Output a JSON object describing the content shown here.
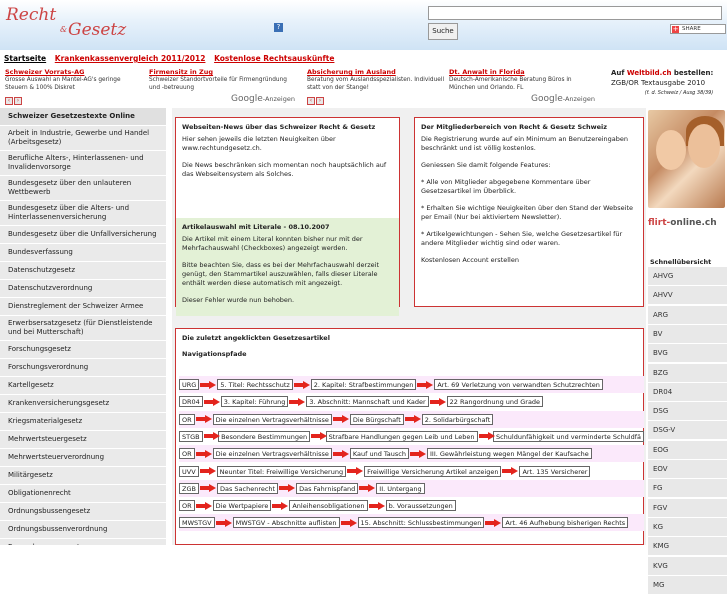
{
  "header": {
    "logo_line1": "Recht",
    "logo_amp": "&",
    "logo_line2": "Gesetz",
    "search_placeholder": "",
    "search_button": "Suche",
    "share_label": "SHARE",
    "help_icon_label": "?"
  },
  "topnav": [
    "Startseite",
    "Krankenkassenvergleich 2011/2012",
    "Kostenlose Rechtsauskünfte"
  ],
  "ads": [
    {
      "title": "Schweizer Vorrats-AG",
      "text": "Grosse Auswahl an Mantel-AG's geringe Steuern & 100% Diskret"
    },
    {
      "title": "Firmensitz in Zug",
      "text": "Schweizer Standortvorteile für Firmengründung und -betreuung"
    },
    {
      "title": "Absicherung im Ausland",
      "text": "Beratung vom Auslandsspezialisten. Individuell statt von der Stange!"
    },
    {
      "title": "Dt. Anwalt in Florida",
      "text": "Deutsch-Amerikanische Beratung Büros in München und Orlando. FL"
    }
  ],
  "google_ads_label": "Google",
  "google_ads_suffix": "-Anzeigen",
  "weltbild": {
    "prefix": "Auf ",
    "link": "Weltbild.ch",
    "suffix": " bestellen:",
    "line2": "ZGB/OR Textausgabe 2010",
    "line3": "(f. d. Schweiz / Ausg 38/39)"
  },
  "sidebar": {
    "heading": "Schweizer Gesetzestexte Online",
    "items": [
      "Arbeit in Industrie, Gewerbe und Handel (Arbeitsgesetz)",
      "Berufliche Alters-, Hinterlassenen- und Invalidenvorsorge",
      "Bundesgesetz über den unlauteren Wettbewerb",
      "Bundesgesetz über die Alters- und Hinterlassenenversicherung",
      "Bundesgesetz über die Unfallversicherung",
      "Bundesverfassung",
      "Datenschutzgesetz",
      "Datenschutzverordnung",
      "Dienstreglement der Schweizer Armee",
      "Erwerbsersatzgesetz (für Dienstleistende und bei Mutterschaft)",
      "Forschungsgesetz",
      "Forschungsverordnung",
      "Kartellgesetz",
      "Krankenversicherungsgesetz",
      "Kriegsmaterialgesetz",
      "Mehrwertsteuergesetz",
      "Mehrwertsteuerverordnung",
      "Militärgesetz",
      "Obligationenrecht",
      "Ordnungsbussengesetz",
      "Ordnungsbussenverordnung",
      "Raumplanungsgesetz"
    ]
  },
  "news": {
    "title": "Webseiten-News über das Schweizer Recht & Gesetz",
    "p1": "Hier sehen jeweils die letzten Neuigkeiten über www.rechtundgesetz.ch.",
    "p2": "Die News beschränken sich momentan noch hauptsächlich auf das Webseitensystem als Solches.",
    "sub_title": "Artikelauswahl mit Literale - 08.10.2007",
    "p3": "Die Artikel mit einem Literal konnten bisher nur mit der Mehrfachauswahl (Checkboxes) angezeigt werden.",
    "p4": "Bitte beachten Sie, dass es bei der Mehrfachauswahl derzeit genügt, den Stammartikel auszuwählen, falls dieser Literale enthält werden diese automatisch mit angezeigt.",
    "p5": "Dieser Fehler wurde nun behoben."
  },
  "member": {
    "title": "Der Mitgliederbereich von Recht & Gesetz Schweiz",
    "p1": "Die Registrierung wurde auf ein Minimum an Benutzereingaben beschränkt und ist völlig kostenlos.",
    "p2": "Geniessen Sie damit folgende Features:",
    "p3": "* Alle von Mitglieder abgegebene Kommentare über Gesetzesartikel im Überblick.",
    "p4": "* Erhalten Sie wichtige Neuigkeiten über den Stand der Webseite per Email (Nur bei aktiviertem Newsletter).",
    "p5": "* Artikelgewichtungen - Sehen Sie, welche Gesetzesartikel für andere Mitglieder wichtig sind oder waren.",
    "p6": "Kostenlosen Account erstellen"
  },
  "recent": {
    "title": "Die zuletzt angeklickten Gesetzesartikel",
    "subtitle": "Navigationspfade",
    "rows": [
      [
        "URG",
        "5. Titel: Rechtsschutz",
        "2. Kapitel: Strafbestimmungen",
        "Art. 69 Verletzung von verwandten Schutzrechten"
      ],
      [
        "DR04",
        "3. Kapitel: Führung",
        "3. Abschnitt: Mannschaft und Kader",
        "22 Rangordnung und Grade"
      ],
      [
        "OR",
        "Die einzelnen Vertragsverhältnisse",
        "Die Bürgschaft",
        "2. Solidarbürgschaft"
      ],
      [
        "STGB",
        "Besondere Bestimmungen",
        "Strafbare Handlungen gegen Leib und Leben",
        "Schuldunfähigkeit und verminderte Schuldfä"
      ],
      [
        "OR",
        "Die einzelnen Vertragsverhältnisse",
        "Kauf und Tausch",
        "III. Gewährleistung wegen Mängel der Kaufsache"
      ],
      [
        "UVV",
        "Neunter Titel: Freiwillige Versicherung",
        "Freiwillige Versicherung Artikel anzeigen",
        "Art. 135 Versicherer"
      ],
      [
        "ZGB",
        "Das Sachenrecht",
        "Das Fahrnispfand",
        "II. Untergang"
      ],
      [
        "OR",
        "Die Wertpapiere",
        "Anleihensobligationen",
        "b. Voraussetzungen"
      ],
      [
        "MWSTGV",
        "MWSTGV - Abschnitte auflisten",
        "15. Abschnitt: Schlussbestimmungen",
        "Art. 46 Aufhebung bisherigen Rechts"
      ]
    ]
  },
  "right": {
    "flirt_a": "flirt-",
    "flirt_b": "online.ch",
    "schnell": "Schnellübersicht",
    "quick": [
      "AHVG",
      "AHVV",
      "ARG",
      "BV",
      "BVG",
      "BZG",
      "DR04",
      "DSG",
      "DSG-V",
      "EOG",
      "EOV",
      "FG",
      "FGV",
      "KG",
      "KMG",
      "KVG",
      "MG"
    ]
  },
  "colors": {
    "accent": "#cc0000",
    "arrow": "#e3241d",
    "sidebar_bg": "#eaeaea",
    "news_highlight": "#e3f1d6",
    "row_alt": "#fbe9fb"
  }
}
